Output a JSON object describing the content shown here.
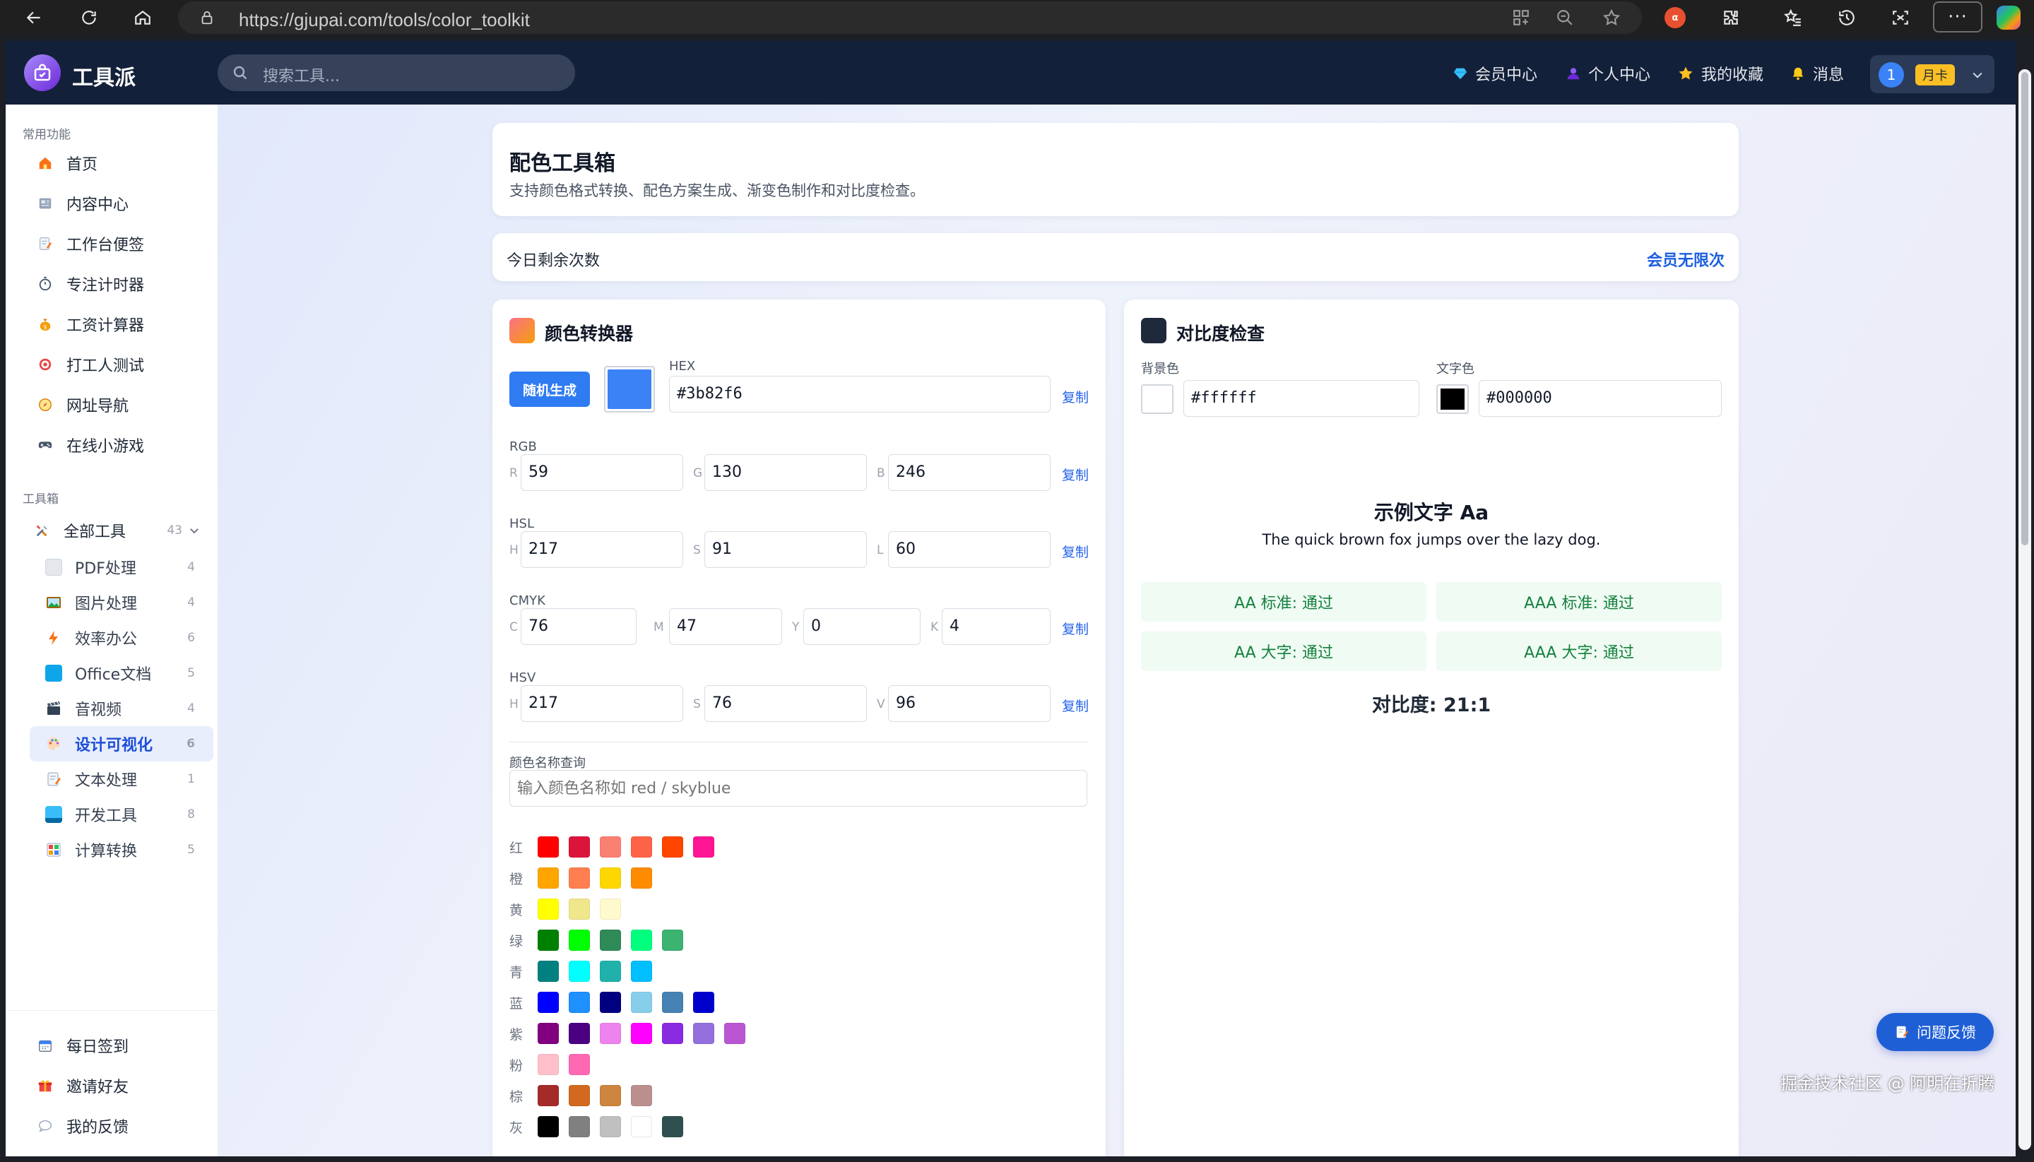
{
  "browser": {
    "url": "https://gjupai.com/tools/color_toolkit",
    "ext_badge": "α"
  },
  "app": {
    "brand": "工具派",
    "search_placeholder": "搜索工具...",
    "nav": {
      "member_center": "会员中心",
      "profile": "个人中心",
      "favorites": "我的收藏",
      "messages": "消息"
    },
    "user": {
      "avatar_num": "1",
      "tier": "月卡"
    }
  },
  "sidebar": {
    "common_title": "常用功能",
    "common": [
      {
        "label": "首页"
      },
      {
        "label": "内容中心"
      },
      {
        "label": "工作台便签"
      },
      {
        "label": "专注计时器"
      },
      {
        "label": "工资计算器"
      },
      {
        "label": "打工人测试"
      },
      {
        "label": "网址导航"
      },
      {
        "label": "在线小游戏"
      }
    ],
    "toolbox_title": "工具箱",
    "all_tools": {
      "label": "全部工具",
      "count": "43"
    },
    "categories": [
      {
        "label": "PDF处理",
        "count": "4"
      },
      {
        "label": "图片处理",
        "count": "4"
      },
      {
        "label": "效率办公",
        "count": "6"
      },
      {
        "label": "Office文档",
        "count": "5"
      },
      {
        "label": "音视频",
        "count": "4"
      },
      {
        "label": "设计可视化",
        "count": "6"
      },
      {
        "label": "文本处理",
        "count": "1"
      },
      {
        "label": "开发工具",
        "count": "8"
      },
      {
        "label": "计算转换",
        "count": "5"
      }
    ],
    "bottom": [
      {
        "label": "每日签到"
      },
      {
        "label": "邀请好友"
      },
      {
        "label": "我的反馈"
      }
    ]
  },
  "header": {
    "title": "配色工具箱",
    "subtitle": "支持颜色格式转换、配色方案生成、渐变色制作和对比度检查。"
  },
  "quota": {
    "label": "今日剩余次数",
    "value": "会员无限次"
  },
  "converter": {
    "title": "颜色转换器",
    "random_btn": "随机生成",
    "preview_color": "#3b82f6",
    "copy_label": "复制",
    "hex": {
      "label": "HEX",
      "value": "#3b82f6"
    },
    "rgb": {
      "label": "RGB",
      "r_p": "R",
      "g_p": "G",
      "b_p": "B",
      "r": "59",
      "g": "130",
      "b": "246"
    },
    "hsl": {
      "label": "HSL",
      "h_p": "H",
      "s_p": "S",
      "l_p": "L",
      "h": "217",
      "s": "91",
      "l": "60"
    },
    "cmyk": {
      "label": "CMYK",
      "c_p": "C",
      "m_p": "M",
      "y_p": "Y",
      "k_p": "K",
      "c": "76",
      "m": "47",
      "y": "0",
      "k": "4"
    },
    "hsv": {
      "label": "HSV",
      "h_p": "H",
      "s_p": "S",
      "v_p": "V",
      "h": "217",
      "s": "76",
      "v": "96"
    },
    "name_lookup": {
      "label": "颜色名称查询",
      "placeholder": "输入颜色名称如 red / skyblue"
    },
    "swatches": [
      {
        "name": "红",
        "colors": [
          "#ff0000",
          "#dc143c",
          "#fa8072",
          "#ff6347",
          "#ff4500",
          "#ff1493"
        ]
      },
      {
        "name": "橙",
        "colors": [
          "#ffa500",
          "#ff7f50",
          "#ffd700",
          "#ff8c00"
        ]
      },
      {
        "name": "黄",
        "colors": [
          "#ffff00",
          "#f0e68c",
          "#fffacd"
        ]
      },
      {
        "name": "绿",
        "colors": [
          "#008000",
          "#00ff00",
          "#2e8b57",
          "#00ff7f",
          "#3cb371"
        ]
      },
      {
        "name": "青",
        "colors": [
          "#008080",
          "#00ffff",
          "#20b2aa",
          "#00bfff"
        ]
      },
      {
        "name": "蓝",
        "colors": [
          "#0000ff",
          "#1e90ff",
          "#000080",
          "#87ceeb",
          "#4682b4",
          "#0000cd"
        ]
      },
      {
        "name": "紫",
        "colors": [
          "#800080",
          "#4b0082",
          "#ee82ee",
          "#ff00ff",
          "#8a2be2",
          "#9370db",
          "#ba55d3"
        ]
      },
      {
        "name": "粉",
        "colors": [
          "#ffc0cb",
          "#ff69b4"
        ]
      },
      {
        "name": "棕",
        "colors": [
          "#a52a2a",
          "#d2691e",
          "#cd853f",
          "#bc8f8f"
        ]
      },
      {
        "name": "灰",
        "colors": [
          "#000000",
          "#808080",
          "#c0c0c0",
          "#ffffff",
          "#2f4f4f"
        ]
      }
    ]
  },
  "contrast": {
    "title": "对比度检查",
    "bg_label": "背景色",
    "bg_value": "#ffffff",
    "fg_label": "文字色",
    "fg_value": "#000000",
    "sample_title": "示例文字 Aa",
    "sample_text": "The quick brown fox jumps over the lazy dog.",
    "results": {
      "aa": "AA 标准: 通过",
      "aaa": "AAA 标准: 通过",
      "aa_large": "AA 大字: 通过",
      "aaa_large": "AAA 大字: 通过"
    },
    "ratio": "对比度: 21:1"
  },
  "feedback": {
    "label": "问题反馈"
  },
  "watermark": "掘金技术社区 @ 阿明在折腾"
}
